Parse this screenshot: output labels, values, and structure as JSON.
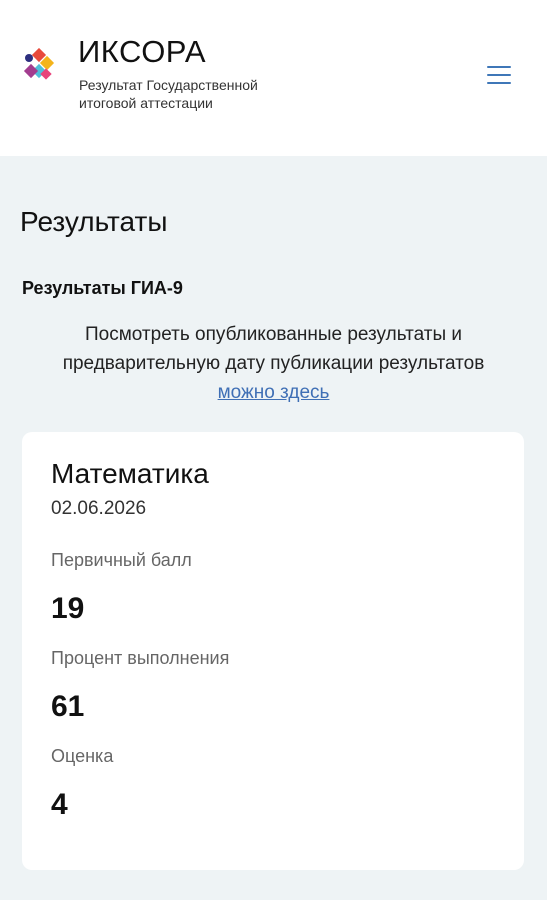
{
  "header": {
    "brand": "ИКСОРА",
    "subtitle": "Результат Государственной итоговой аттестации",
    "logo_icon": "colorful-diamonds-logo",
    "menu_icon": "hamburger-menu-icon",
    "accent_color": "#3f77b8"
  },
  "main": {
    "title": "Результаты",
    "section_title": "Результаты ГИА-9",
    "info_text_line1": "Посмотреть опубликованные результаты и",
    "info_text_line2": "предварительную дату публикации результатов",
    "info_link": "можно здесь"
  },
  "result_card": {
    "subject": "Математика",
    "date": "02.06.2026",
    "primary_score_label": "Первичный балл",
    "primary_score": "19",
    "percent_label": "Процент выполнения",
    "percent": "61",
    "grade_label": "Оценка",
    "grade": "4"
  }
}
